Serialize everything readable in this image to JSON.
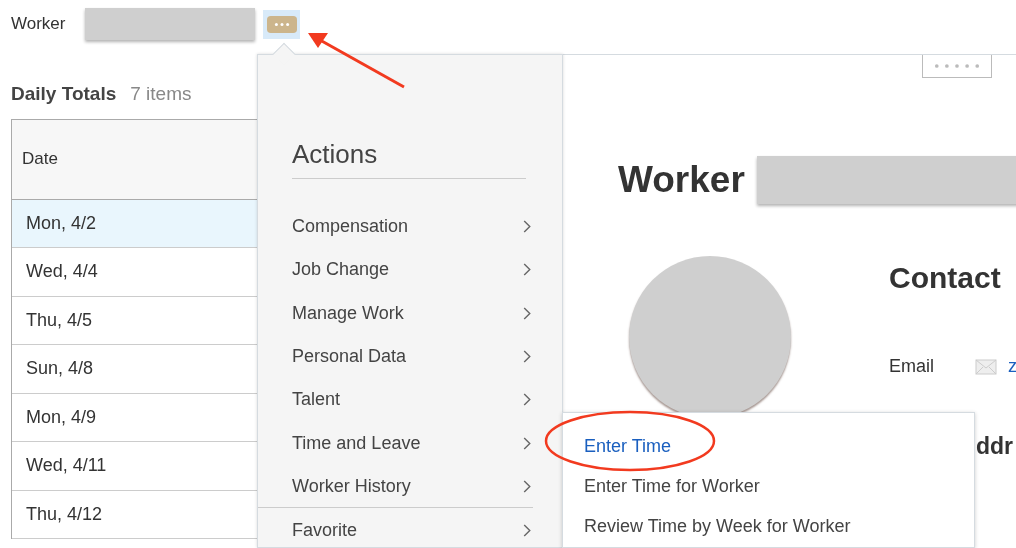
{
  "header": {
    "label": "Worker"
  },
  "daily_totals": {
    "title": "Daily Totals",
    "count": "7 items",
    "columns": [
      "Date"
    ],
    "rows": [
      {
        "date": "Mon, 4/2",
        "selected": true
      },
      {
        "date": "Wed, 4/4",
        "selected": false
      },
      {
        "date": "Thu, 4/5",
        "selected": false
      },
      {
        "date": "Sun, 4/8",
        "selected": false
      },
      {
        "date": "Mon, 4/9",
        "selected": false
      },
      {
        "date": "Wed, 4/11",
        "selected": false
      },
      {
        "date": "Thu, 4/12",
        "selected": false
      }
    ]
  },
  "actions_menu": {
    "title": "Actions",
    "items": [
      {
        "label": "Compensation"
      },
      {
        "label": "Job Change"
      },
      {
        "label": "Manage Work"
      },
      {
        "label": "Personal Data"
      },
      {
        "label": "Talent"
      },
      {
        "label": "Time and Leave"
      },
      {
        "label": "Worker History"
      }
    ],
    "footer_items": [
      {
        "label": "Favorite"
      }
    ]
  },
  "submenu": {
    "items": [
      {
        "label": "Enter Time",
        "selected": true
      },
      {
        "label": "Enter Time for Worker",
        "selected": false
      },
      {
        "label": "Review Time by Week for Worker",
        "selected": false
      }
    ]
  },
  "profile": {
    "title": "Worker",
    "section": "Contact",
    "fields": [
      {
        "label": "Email",
        "value": "z"
      }
    ],
    "next_section": "ddr"
  }
}
